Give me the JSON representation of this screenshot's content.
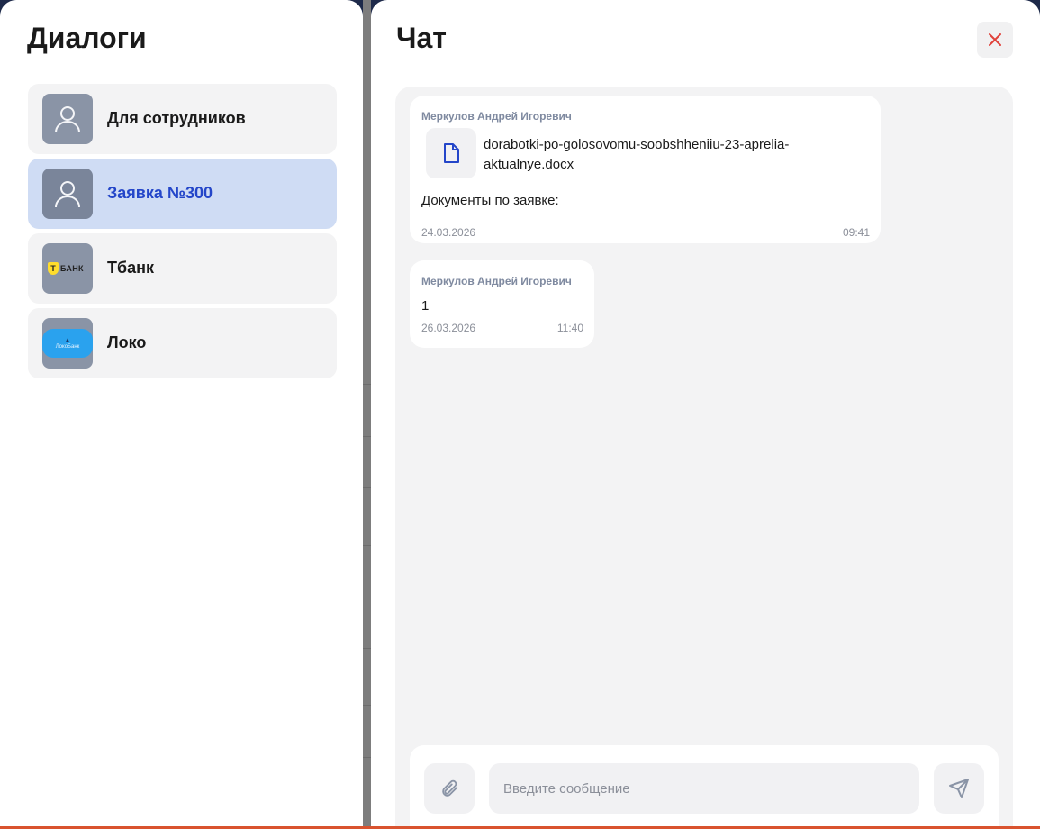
{
  "dialogs": {
    "title": "Диалоги",
    "items": [
      {
        "label": "Для сотрудников",
        "avatar": "person-icon",
        "active": false
      },
      {
        "label": "Заявка №300",
        "avatar": "person-icon",
        "active": true
      },
      {
        "label": "Тбанк",
        "avatar": "tbank-logo",
        "logo_text": "БАНК",
        "logo_mark": "Т",
        "active": false
      },
      {
        "label": "Локо",
        "avatar": "loko-logo",
        "logo_text": "ЛокоБанк",
        "active": false
      }
    ]
  },
  "chat": {
    "title": "Чат",
    "close_icon": "close-icon",
    "messages": [
      {
        "author": "Меркулов Андрей Игоревич",
        "attachment": "dorabotki-po-golosovomu-soobshheniiu-23-aprelia-aktualnye.docx",
        "text": "Документы по заявке:",
        "date": "24.03.2026",
        "time": "09:41"
      },
      {
        "author": "Меркулов Андрей Игоревич",
        "text": "1",
        "date": "26.03.2026",
        "time": "11:40"
      }
    ],
    "composer": {
      "placeholder": "Введите сообщение",
      "value": "",
      "attach_icon": "paperclip-icon",
      "send_icon": "send-icon"
    }
  },
  "colors": {
    "accent": "#2446c9",
    "active_bg": "#cfdcf4",
    "close": "#e0413a"
  }
}
